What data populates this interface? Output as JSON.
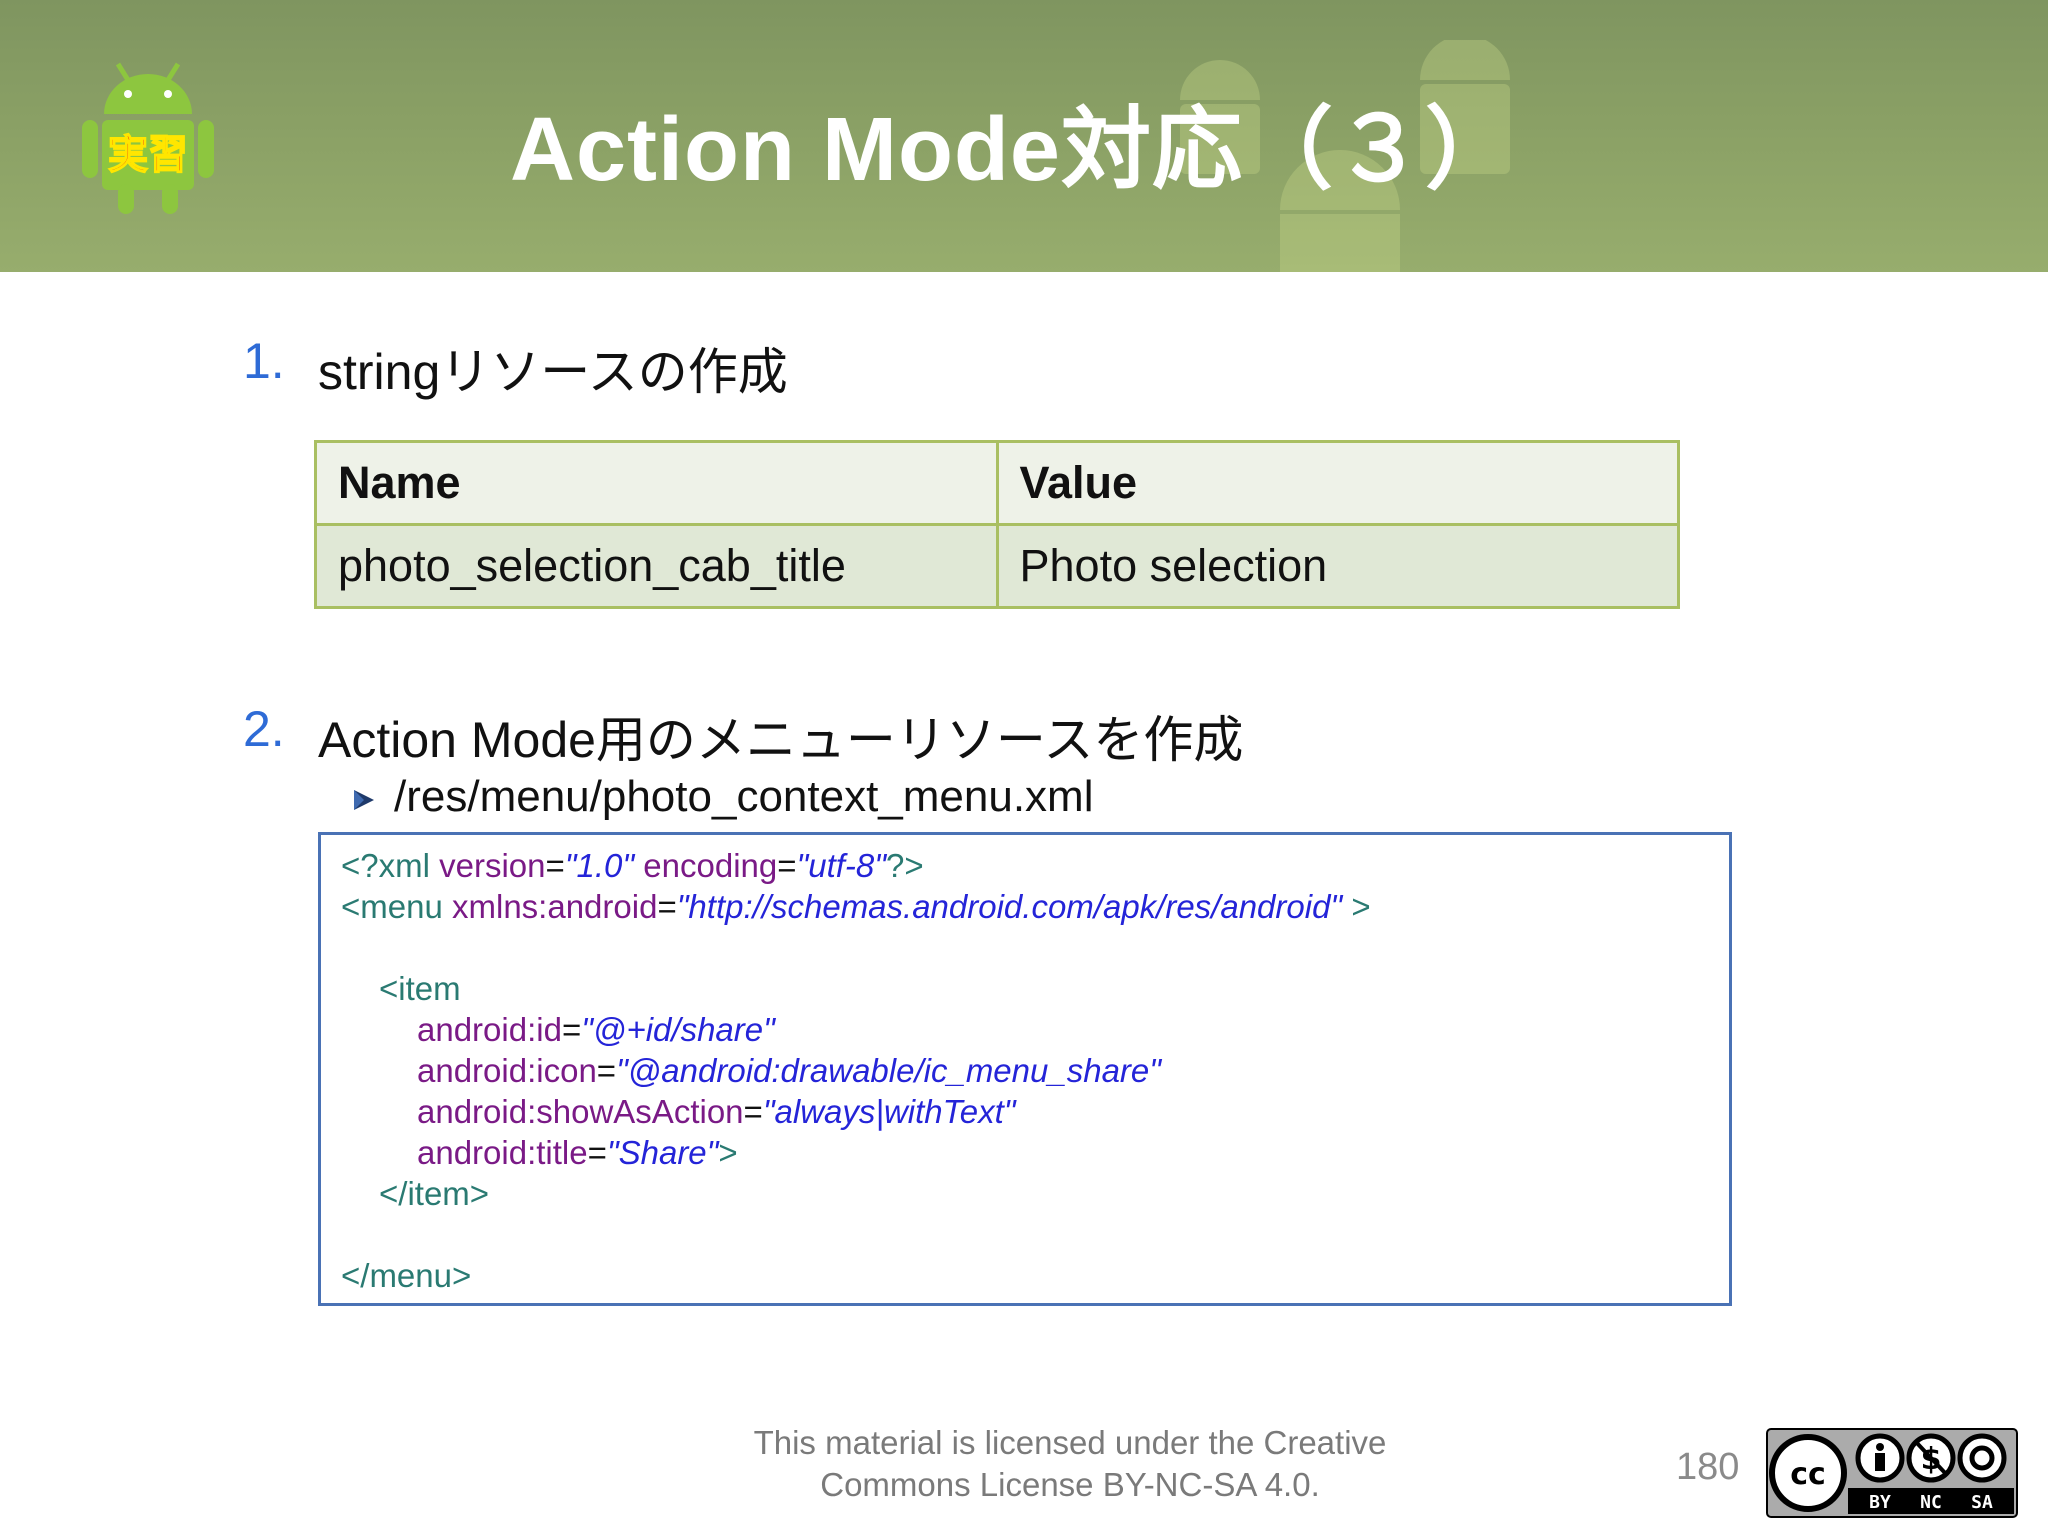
{
  "header": {
    "title": "Action Mode対応（３）",
    "logo_label": "実習"
  },
  "list": [
    {
      "number": "1.",
      "text": "stringリソースの作成"
    },
    {
      "number": "2.",
      "text": "Action Mode用のメニューリソースを作成"
    }
  ],
  "table": {
    "headers": [
      "Name",
      "Value"
    ],
    "rows": [
      [
        "photo_selection_cab_title",
        "Photo selection"
      ]
    ]
  },
  "sub_item": "/res/menu/photo_context_menu.xml",
  "code": {
    "l1_open": "<?xml ",
    "l1_attr1": "version",
    "l1_eq1": "=",
    "l1_val1": "\"1.0\"",
    "l1_attr2": " encoding",
    "l1_eq2": "=",
    "l1_val2": "\"utf-8\"",
    "l1_close": "?>",
    "l2_open": "<menu ",
    "l2_attr": "xmlns:android",
    "l2_eq": "=",
    "l2_val": "\"http://schemas.android.com/apk/res/android\"",
    "l2_close": " >",
    "l3": "<item",
    "l4_attr": "android:id",
    "l4_val": "\"@+id/share\"",
    "l5_attr": "android:icon",
    "l5_val": "\"@android:drawable/ic_menu_share\"",
    "l6_attr": "android:showAsAction",
    "l6_val": "\"always|withText\"",
    "l7_attr": "android:title",
    "l7_val": "\"Share\"",
    "l7_close": ">",
    "eq": "=",
    "l8": "</item>",
    "l9": "</menu>"
  },
  "footer": {
    "license_line1": "This material is licensed under the Creative",
    "license_line2": "Commons License BY-NC-SA 4.0.",
    "page_number": "180",
    "badge_labels": [
      "BY",
      "NC",
      "SA"
    ]
  },
  "colors": {
    "header_green": "#8aa065",
    "list_number_blue": "#2e6bd6",
    "table_border": "#a9bf62",
    "code_border": "#4a72b5"
  }
}
